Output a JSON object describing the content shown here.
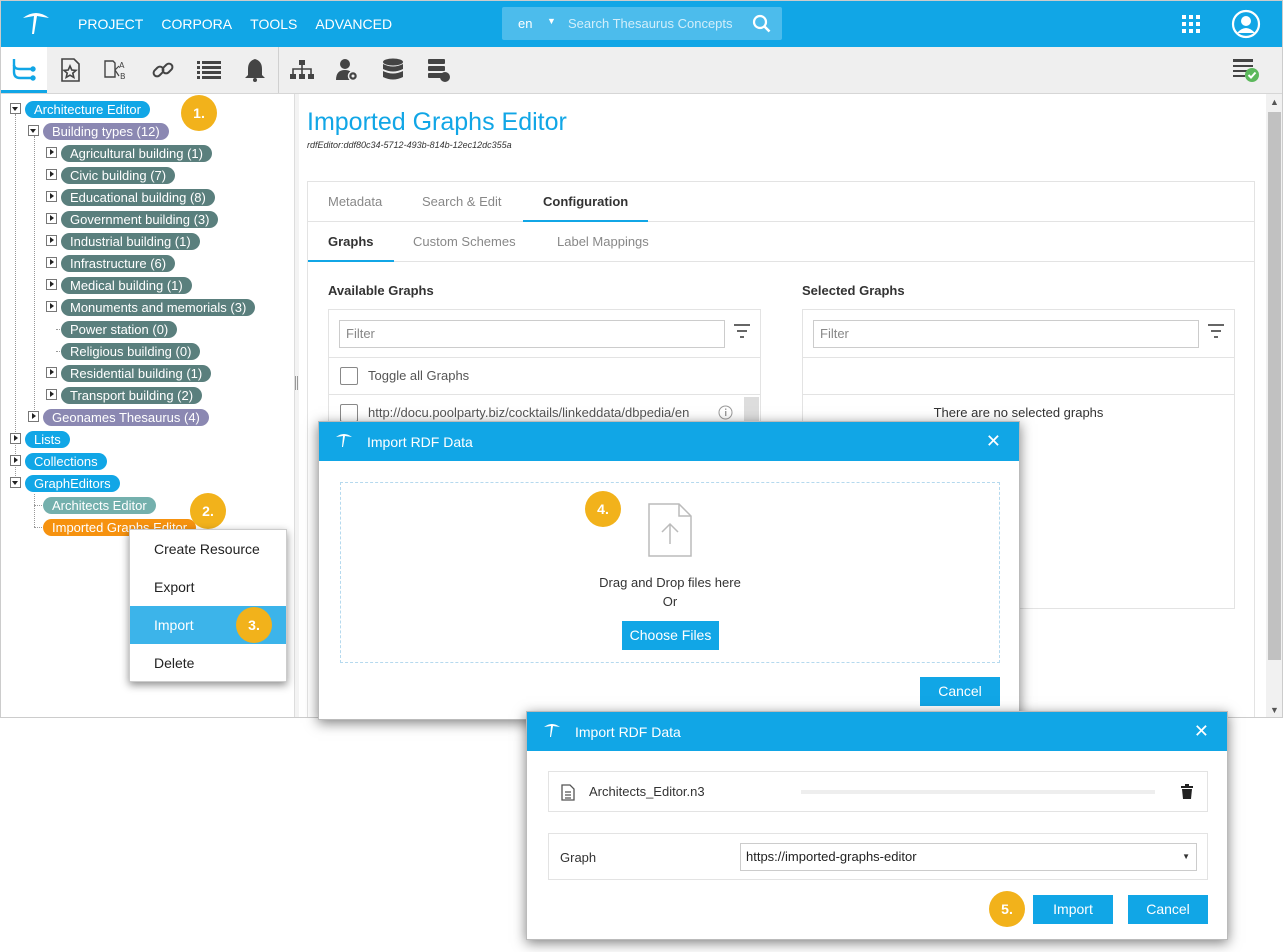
{
  "topnav": {
    "items": [
      "PROJECT",
      "CORPORA",
      "TOOLS",
      "ADVANCED"
    ]
  },
  "search": {
    "lang": "en",
    "placeholder": "Search Thesaurus Concepts"
  },
  "tree": {
    "root": "Architecture Editor",
    "building_types": "Building types (12)",
    "children": [
      "Agricultural building (1)",
      "Civic building (7)",
      "Educational building (8)",
      "Government building (3)",
      "Industrial building (1)",
      "Infrastructure (6)",
      "Medical building (1)",
      "Monuments and memorials (3)",
      "Power station (0)",
      "Religious building (0)",
      "Residential building (1)",
      "Transport building (2)"
    ],
    "geonames": "Geonames Thesaurus (4)",
    "lists": "Lists",
    "collections": "Collections",
    "grapheditors": "GraphEditors",
    "architects_editor": "Architects Editor",
    "imported_graphs_editor": "Imported Graphs Editor"
  },
  "badges": {
    "b1": "1.",
    "b2": "2.",
    "b3": "3.",
    "b4": "4.",
    "b5": "5."
  },
  "context_menu": {
    "items": [
      "Create Resource",
      "Export",
      "Import",
      "Delete"
    ]
  },
  "main": {
    "title": "Imported Graphs Editor",
    "id": "rdfEditor:ddf80c34-5712-493b-814b-12ec12dc355a",
    "tabs": [
      "Metadata",
      "Search & Edit",
      "Configuration"
    ],
    "subtabs": [
      "Graphs",
      "Custom Schemes",
      "Label Mappings"
    ],
    "available_title": "Available Graphs",
    "selected_title": "Selected Graphs",
    "filter_placeholder": "Filter",
    "toggle_all": "Toggle all Graphs",
    "graph_row": "http://docu.poolparty.biz/cocktails/linkeddata/dbpedia/en",
    "no_selected": "There are no selected graphs"
  },
  "modal1": {
    "title": "Import RDF Data",
    "drag_text": "Drag and Drop files here",
    "or_text": "Or",
    "choose_label": "Choose Files",
    "cancel_label": "Cancel"
  },
  "modal2": {
    "title": "Import RDF Data",
    "filename": "Architects_Editor.n3",
    "graph_label": "Graph",
    "graph_value": "https://imported-graphs-editor",
    "import_label": "Import",
    "cancel_label": "Cancel"
  },
  "colors": {
    "accent": "#11a6e6",
    "badge": "#f2b21b",
    "orange_node": "#f6920f"
  }
}
